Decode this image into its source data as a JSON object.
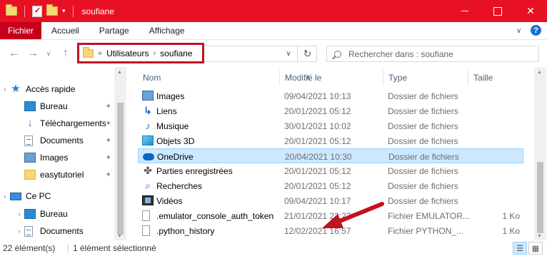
{
  "window": {
    "title": "soufiane",
    "accent": "#e81123"
  },
  "ribbon": {
    "tabs": [
      "Fichier",
      "Accueil",
      "Partage",
      "Affichage"
    ]
  },
  "address": {
    "overflow": "«",
    "crumbs": [
      "Utilisateurs",
      "soufiane"
    ],
    "separator": "›"
  },
  "search": {
    "placeholder": "Rechercher dans : soufiane"
  },
  "nav": {
    "quick_access": "Accès rapide",
    "items": [
      {
        "label": "Bureau",
        "icon": "desktop-icon",
        "pinned": true
      },
      {
        "label": "Téléchargements",
        "icon": "download-icon",
        "pinned": true
      },
      {
        "label": "Documents",
        "icon": "documents-icon",
        "pinned": true
      },
      {
        "label": "Images",
        "icon": "pictures-icon",
        "pinned": true
      },
      {
        "label": "easytutoriel",
        "icon": "folder-icon",
        "pinned": true
      }
    ],
    "this_pc": "Ce PC",
    "pc_items": [
      {
        "label": "Bureau",
        "icon": "desktop-icon"
      },
      {
        "label": "Documents",
        "icon": "documents-icon"
      }
    ]
  },
  "columns": {
    "name": "Nom",
    "modified": "Modifié le",
    "type": "Type",
    "size": "Taille"
  },
  "files": [
    {
      "name": "Images",
      "date": "09/04/2021 10:13",
      "type": "Dossier de fichiers",
      "size": "",
      "icon": "pictures-icon"
    },
    {
      "name": "Liens",
      "date": "20/01/2021 05:12",
      "type": "Dossier de fichiers",
      "size": "",
      "icon": "links-icon"
    },
    {
      "name": "Musique",
      "date": "30/01/2021 10:02",
      "type": "Dossier de fichiers",
      "size": "",
      "icon": "music-icon"
    },
    {
      "name": "Objets 3D",
      "date": "20/01/2021 05:12",
      "type": "Dossier de fichiers",
      "size": "",
      "icon": "objects-3d-icon"
    },
    {
      "name": "OneDrive",
      "date": "20/04/2021 10:30",
      "type": "Dossier de fichiers",
      "size": "",
      "icon": "onedrive-cloud-icon",
      "selected": true
    },
    {
      "name": "Parties enregistrées",
      "date": "20/01/2021 05:12",
      "type": "Dossier de fichiers",
      "size": "",
      "icon": "saved-games-icon"
    },
    {
      "name": "Recherches",
      "date": "20/01/2021 05:12",
      "type": "Dossier de fichiers",
      "size": "",
      "icon": "searches-icon"
    },
    {
      "name": "Vidéos",
      "date": "09/04/2021 10:17",
      "type": "Dossier de fichiers",
      "size": "",
      "icon": "videos-icon"
    },
    {
      "name": ".emulator_console_auth_token",
      "date": "21/01/2021 22:23",
      "type": "Fichier EMULATOR...",
      "size": "1 Ko",
      "icon": "file-icon"
    },
    {
      "name": ".python_history",
      "date": "12/02/2021 16:57",
      "type": "Fichier PYTHON_...",
      "size": "1 Ko",
      "icon": "file-icon"
    }
  ],
  "status": {
    "count": "22 élément(s)",
    "selection": "1 élément sélectionné"
  }
}
